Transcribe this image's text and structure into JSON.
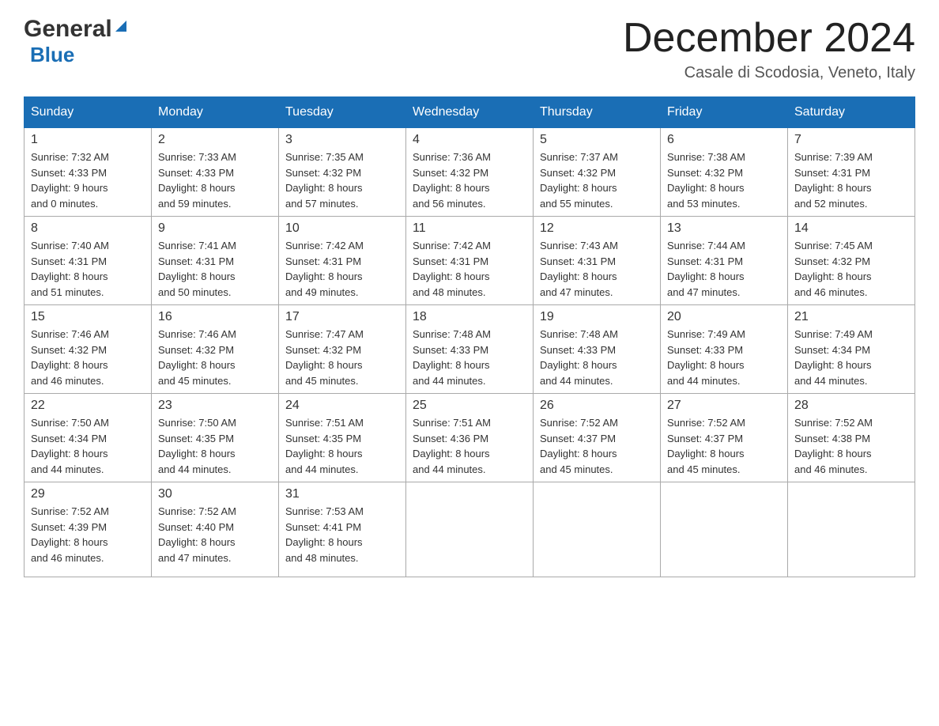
{
  "logo": {
    "general": "General",
    "blue": "Blue"
  },
  "header": {
    "title": "December 2024",
    "location": "Casale di Scodosia, Veneto, Italy"
  },
  "days_of_week": [
    "Sunday",
    "Monday",
    "Tuesday",
    "Wednesday",
    "Thursday",
    "Friday",
    "Saturday"
  ],
  "weeks": [
    [
      {
        "day": "1",
        "sunrise": "7:32 AM",
        "sunset": "4:33 PM",
        "daylight": "9 hours",
        "daylight2": "and 0 minutes."
      },
      {
        "day": "2",
        "sunrise": "7:33 AM",
        "sunset": "4:33 PM",
        "daylight": "8 hours",
        "daylight2": "and 59 minutes."
      },
      {
        "day": "3",
        "sunrise": "7:35 AM",
        "sunset": "4:32 PM",
        "daylight": "8 hours",
        "daylight2": "and 57 minutes."
      },
      {
        "day": "4",
        "sunrise": "7:36 AM",
        "sunset": "4:32 PM",
        "daylight": "8 hours",
        "daylight2": "and 56 minutes."
      },
      {
        "day": "5",
        "sunrise": "7:37 AM",
        "sunset": "4:32 PM",
        "daylight": "8 hours",
        "daylight2": "and 55 minutes."
      },
      {
        "day": "6",
        "sunrise": "7:38 AM",
        "sunset": "4:32 PM",
        "daylight": "8 hours",
        "daylight2": "and 53 minutes."
      },
      {
        "day": "7",
        "sunrise": "7:39 AM",
        "sunset": "4:31 PM",
        "daylight": "8 hours",
        "daylight2": "and 52 minutes."
      }
    ],
    [
      {
        "day": "8",
        "sunrise": "7:40 AM",
        "sunset": "4:31 PM",
        "daylight": "8 hours",
        "daylight2": "and 51 minutes."
      },
      {
        "day": "9",
        "sunrise": "7:41 AM",
        "sunset": "4:31 PM",
        "daylight": "8 hours",
        "daylight2": "and 50 minutes."
      },
      {
        "day": "10",
        "sunrise": "7:42 AM",
        "sunset": "4:31 PM",
        "daylight": "8 hours",
        "daylight2": "and 49 minutes."
      },
      {
        "day": "11",
        "sunrise": "7:42 AM",
        "sunset": "4:31 PM",
        "daylight": "8 hours",
        "daylight2": "and 48 minutes."
      },
      {
        "day": "12",
        "sunrise": "7:43 AM",
        "sunset": "4:31 PM",
        "daylight": "8 hours",
        "daylight2": "and 47 minutes."
      },
      {
        "day": "13",
        "sunrise": "7:44 AM",
        "sunset": "4:31 PM",
        "daylight": "8 hours",
        "daylight2": "and 47 minutes."
      },
      {
        "day": "14",
        "sunrise": "7:45 AM",
        "sunset": "4:32 PM",
        "daylight": "8 hours",
        "daylight2": "and 46 minutes."
      }
    ],
    [
      {
        "day": "15",
        "sunrise": "7:46 AM",
        "sunset": "4:32 PM",
        "daylight": "8 hours",
        "daylight2": "and 46 minutes."
      },
      {
        "day": "16",
        "sunrise": "7:46 AM",
        "sunset": "4:32 PM",
        "daylight": "8 hours",
        "daylight2": "and 45 minutes."
      },
      {
        "day": "17",
        "sunrise": "7:47 AM",
        "sunset": "4:32 PM",
        "daylight": "8 hours",
        "daylight2": "and 45 minutes."
      },
      {
        "day": "18",
        "sunrise": "7:48 AM",
        "sunset": "4:33 PM",
        "daylight": "8 hours",
        "daylight2": "and 44 minutes."
      },
      {
        "day": "19",
        "sunrise": "7:48 AM",
        "sunset": "4:33 PM",
        "daylight": "8 hours",
        "daylight2": "and 44 minutes."
      },
      {
        "day": "20",
        "sunrise": "7:49 AM",
        "sunset": "4:33 PM",
        "daylight": "8 hours",
        "daylight2": "and 44 minutes."
      },
      {
        "day": "21",
        "sunrise": "7:49 AM",
        "sunset": "4:34 PM",
        "daylight": "8 hours",
        "daylight2": "and 44 minutes."
      }
    ],
    [
      {
        "day": "22",
        "sunrise": "7:50 AM",
        "sunset": "4:34 PM",
        "daylight": "8 hours",
        "daylight2": "and 44 minutes."
      },
      {
        "day": "23",
        "sunrise": "7:50 AM",
        "sunset": "4:35 PM",
        "daylight": "8 hours",
        "daylight2": "and 44 minutes."
      },
      {
        "day": "24",
        "sunrise": "7:51 AM",
        "sunset": "4:35 PM",
        "daylight": "8 hours",
        "daylight2": "and 44 minutes."
      },
      {
        "day": "25",
        "sunrise": "7:51 AM",
        "sunset": "4:36 PM",
        "daylight": "8 hours",
        "daylight2": "and 44 minutes."
      },
      {
        "day": "26",
        "sunrise": "7:52 AM",
        "sunset": "4:37 PM",
        "daylight": "8 hours",
        "daylight2": "and 45 minutes."
      },
      {
        "day": "27",
        "sunrise": "7:52 AM",
        "sunset": "4:37 PM",
        "daylight": "8 hours",
        "daylight2": "and 45 minutes."
      },
      {
        "day": "28",
        "sunrise": "7:52 AM",
        "sunset": "4:38 PM",
        "daylight": "8 hours",
        "daylight2": "and 46 minutes."
      }
    ],
    [
      {
        "day": "29",
        "sunrise": "7:52 AM",
        "sunset": "4:39 PM",
        "daylight": "8 hours",
        "daylight2": "and 46 minutes."
      },
      {
        "day": "30",
        "sunrise": "7:52 AM",
        "sunset": "4:40 PM",
        "daylight": "8 hours",
        "daylight2": "and 47 minutes."
      },
      {
        "day": "31",
        "sunrise": "7:53 AM",
        "sunset": "4:41 PM",
        "daylight": "8 hours",
        "daylight2": "and 48 minutes."
      },
      null,
      null,
      null,
      null
    ]
  ]
}
